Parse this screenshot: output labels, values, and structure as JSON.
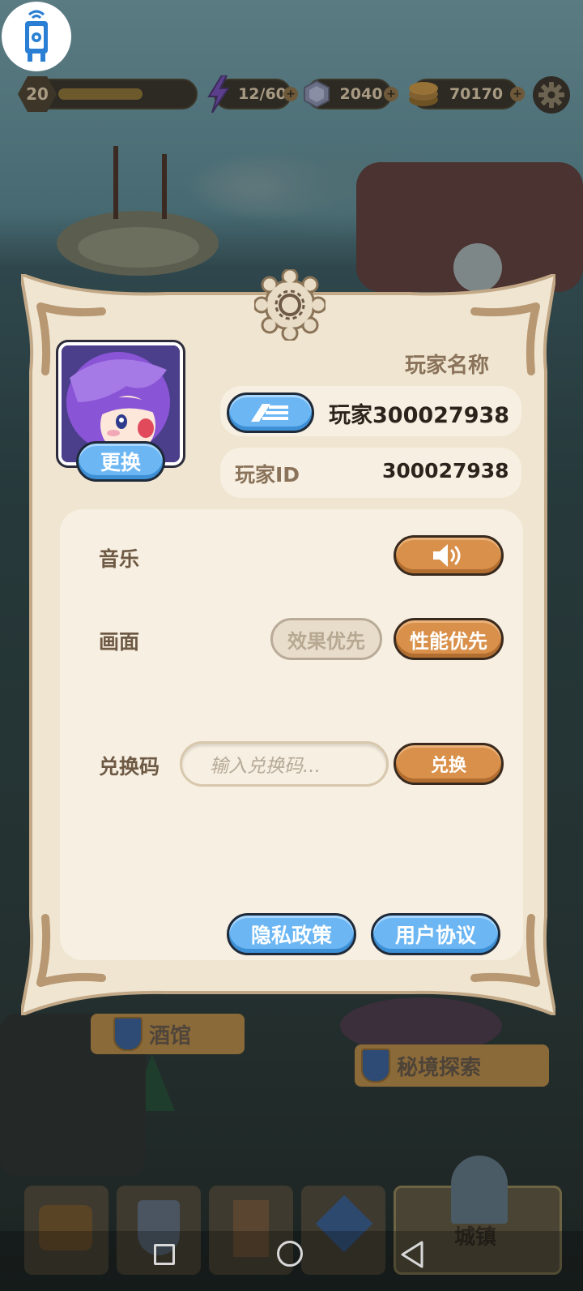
{
  "top_bar": {
    "level": "20",
    "level_progress": 0.65,
    "energy": "12/60",
    "gems": "2040",
    "coins": "70170",
    "plus_symbol": "+",
    "icons": [
      "app-shortcut-icon",
      "lightning-icon",
      "gem-icon",
      "coin-icon",
      "gear-icon"
    ]
  },
  "background_labels": {
    "tavern": "酒馆",
    "secret_explore": "秘境探索",
    "town": "城镇"
  },
  "settings": {
    "player_name_label": "玩家名称",
    "player_name": "玩家300027938",
    "player_id_label": "玩家ID",
    "player_id": "300027938",
    "change_avatar_button": "更换",
    "music_label": "音乐",
    "music_state": "on",
    "graphics_label": "画面",
    "graphics_options": [
      "效果优先",
      "性能优先"
    ],
    "graphics_selected": "性能优先",
    "redeem_label": "兑换码",
    "redeem_placeholder": "输入兑换码...",
    "redeem_button": "兑换",
    "privacy_button": "隐私政策",
    "agreement_button": "用户协议"
  },
  "colors": {
    "panel": "#efe5d1",
    "card": "#f7efe1",
    "label_brown": "#6e5a44",
    "orange_button": "#d9904a",
    "blue_button": "#6cb7f3",
    "avatar_hair": "#8a54d6"
  }
}
